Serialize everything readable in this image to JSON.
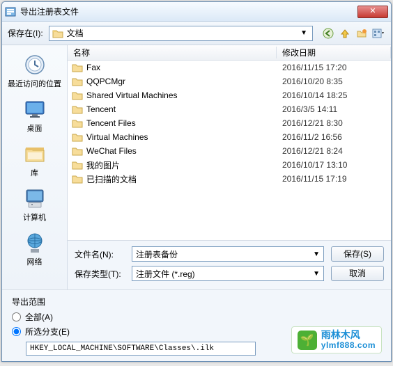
{
  "window": {
    "title": "导出注册表文件",
    "close_glyph": "✕"
  },
  "toolbar": {
    "save_in_label": "保存在(I):",
    "location": "文档",
    "drop_glyph": "▼"
  },
  "places": [
    {
      "label": "最近访问的位置"
    },
    {
      "label": "桌面"
    },
    {
      "label": "库"
    },
    {
      "label": "计算机"
    },
    {
      "label": "网络"
    }
  ],
  "columns": {
    "name": "名称",
    "date": "修改日期"
  },
  "files": [
    {
      "name": "Fax",
      "date": "2016/11/15 17:20"
    },
    {
      "name": "QQPCMgr",
      "date": "2016/10/20 8:35"
    },
    {
      "name": "Shared Virtual Machines",
      "date": "2016/10/14 18:25"
    },
    {
      "name": "Tencent",
      "date": "2016/3/5 14:11"
    },
    {
      "name": "Tencent Files",
      "date": "2016/12/21 8:30"
    },
    {
      "name": "Virtual Machines",
      "date": "2016/11/2 16:56"
    },
    {
      "name": "WeChat Files",
      "date": "2016/12/21 8:24"
    },
    {
      "name": "我的图片",
      "date": "2016/10/17 13:10"
    },
    {
      "name": "已扫描的文档",
      "date": "2016/11/15 17:19"
    }
  ],
  "form": {
    "filename_label": "文件名(N):",
    "filename_value": "注册表备份",
    "filetype_label": "保存类型(T):",
    "filetype_value": "注册文件 (*.reg)",
    "save_btn": "保存(S)",
    "cancel_btn": "取消"
  },
  "export": {
    "group_title": "导出范围",
    "radio_all": "全部(A)",
    "radio_branch": "所选分支(E)",
    "branch_path": "HKEY_LOCAL_MACHINE\\SOFTWARE\\Classes\\.ilk"
  },
  "watermark": {
    "cn": "雨林木风",
    "url": "ylmf888.com"
  }
}
